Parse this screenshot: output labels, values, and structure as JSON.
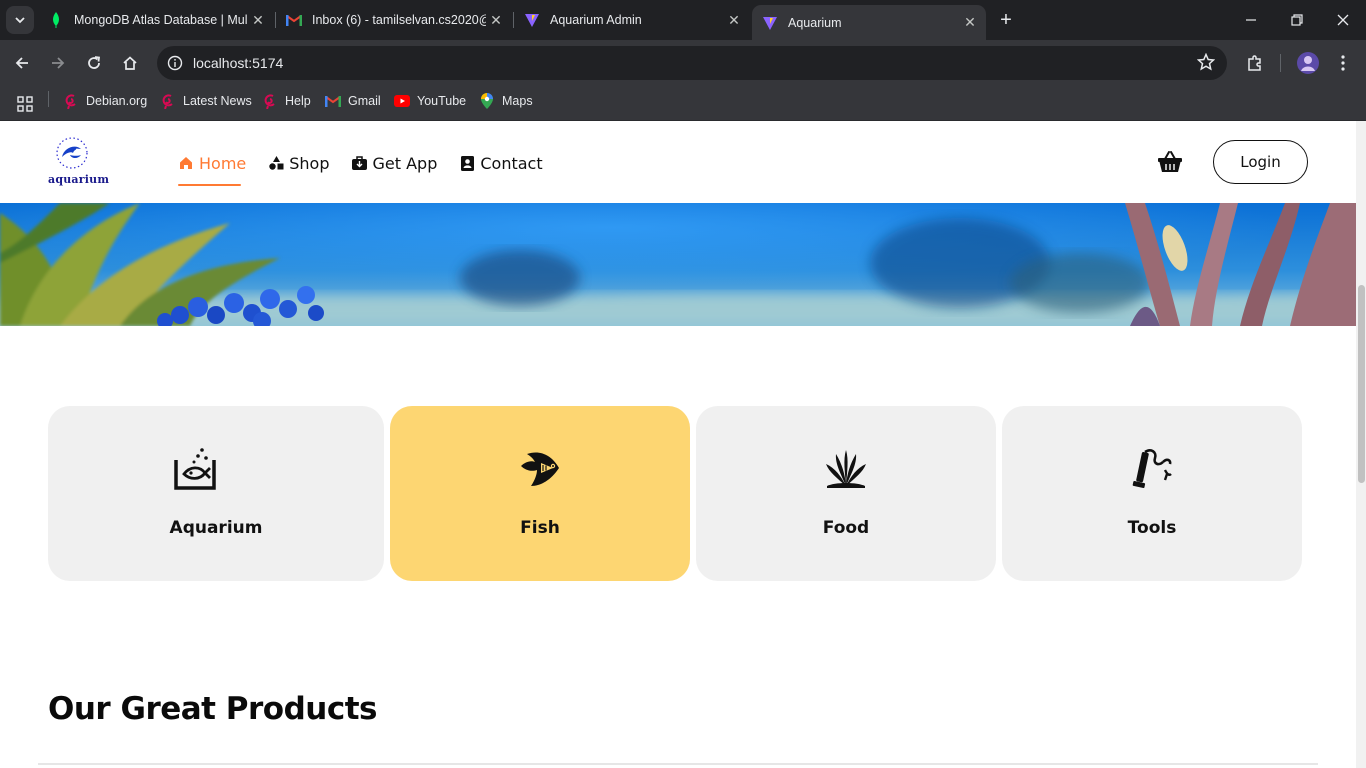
{
  "browser": {
    "tabs": [
      {
        "title": "MongoDB Atlas Database | Mul",
        "favicon": "mongodb-leaf-icon",
        "active": false
      },
      {
        "title": "Inbox (6) - tamilselvan.cs2020@",
        "favicon": "gmail-icon",
        "active": false
      },
      {
        "title": "Aquarium Admin",
        "favicon": "vite-icon",
        "active": false
      },
      {
        "title": "Aquarium",
        "favicon": "vite-icon",
        "active": true
      }
    ],
    "url": "localhost:5174",
    "bookmarks": [
      {
        "label": "Debian.org",
        "icon": "debian-swirl-icon"
      },
      {
        "label": "Latest News",
        "icon": "debian-swirl-icon"
      },
      {
        "label": "Help",
        "icon": "debian-swirl-icon"
      },
      {
        "label": "Gmail",
        "icon": "gmail-icon"
      },
      {
        "label": "YouTube",
        "icon": "youtube-icon"
      },
      {
        "label": "Maps",
        "icon": "maps-pin-icon"
      }
    ],
    "colors": {
      "frame": "#202124",
      "toolbar": "#35363a",
      "text": "#e8eaed"
    }
  },
  "site": {
    "logo_text": "aquarium",
    "nav": [
      {
        "label": "Home",
        "icon": "home-icon",
        "active": true
      },
      {
        "label": "Shop",
        "icon": "shapes-icon",
        "active": false
      },
      {
        "label": "Get App",
        "icon": "app-download-icon",
        "active": false
      },
      {
        "label": "Contact",
        "icon": "contact-card-icon",
        "active": false
      }
    ],
    "login_label": "Login",
    "accent_color": "#ff7a33",
    "categories": [
      {
        "label": "Aquarium",
        "icon": "fish-tank-icon",
        "active": false
      },
      {
        "label": "Fish",
        "icon": "angelfish-icon",
        "active": true
      },
      {
        "label": "Food",
        "icon": "aquatic-plant-icon",
        "active": false
      },
      {
        "label": "Tools",
        "icon": "aquarium-tools-icon",
        "active": false
      }
    ],
    "category_active_color": "#fdd672",
    "section_title": "Our Great Products"
  }
}
